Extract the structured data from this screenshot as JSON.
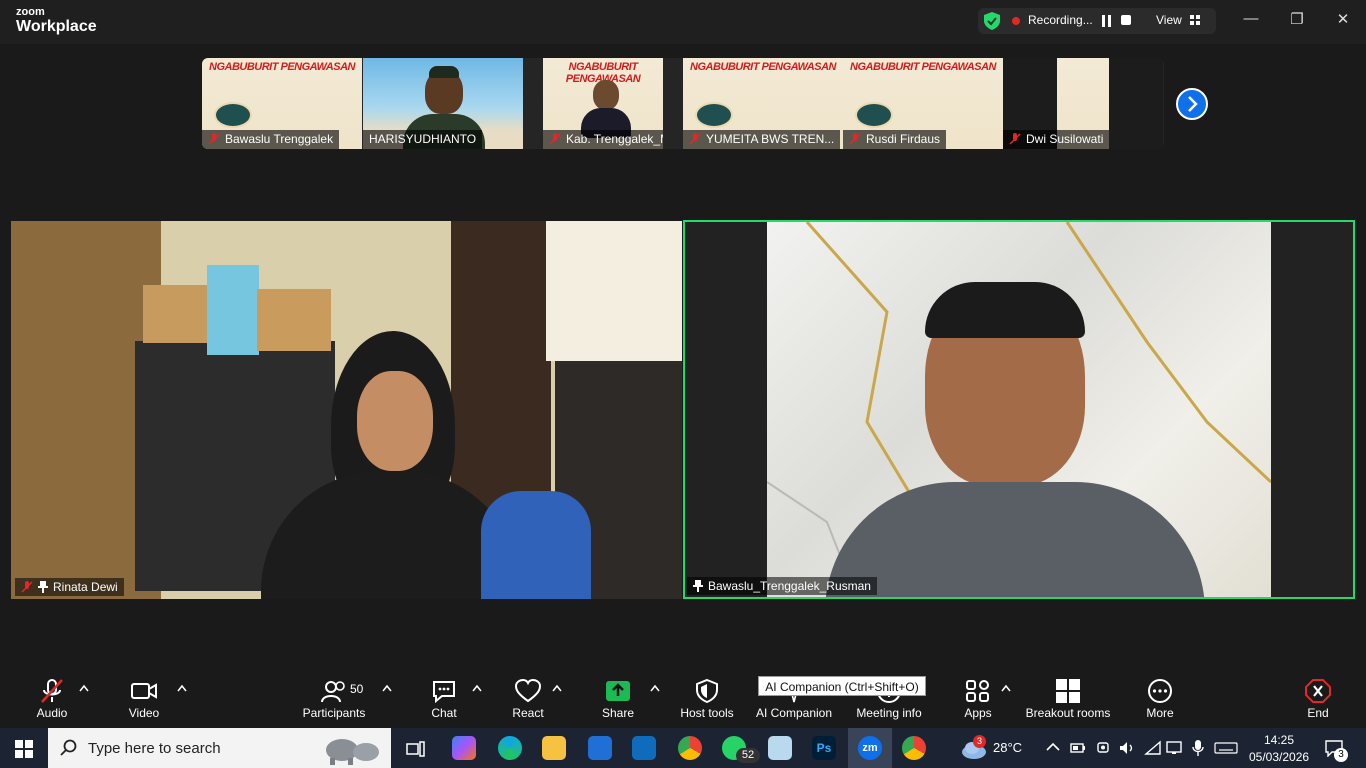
{
  "app": {
    "brand_small": "zoom",
    "brand_big": "Workplace"
  },
  "recording": {
    "status": "Recording...",
    "view_label": "View"
  },
  "thumbnails": [
    {
      "name": "Bawaslu Trenggalek",
      "muted": true
    },
    {
      "name": "HARISYUDHIANTO",
      "muted": false
    },
    {
      "name": "Kab. Trenggalek_Mas...",
      "muted": true
    },
    {
      "name": "YUMEITA BWS TREN...",
      "muted": true
    },
    {
      "name": "Rusdi Firdaus",
      "muted": true
    },
    {
      "name": "Dwi Susilowati",
      "muted": true
    }
  ],
  "poster_title": "NGABUBURIT PENGAWASAN",
  "videos": {
    "left": {
      "name": "Rinata Dewi"
    },
    "right": {
      "name": "Bawaslu_Trenggalek_Rusman"
    }
  },
  "toolbar": {
    "audio": "Audio",
    "video": "Video",
    "participants": "Participants",
    "participants_count": "50",
    "chat": "Chat",
    "react": "React",
    "share": "Share",
    "host_tools": "Host tools",
    "ai_companion": "AI Companion",
    "ai_tooltip": "AI Companion (Ctrl+Shift+O)",
    "meeting_info": "Meeting info",
    "apps": "Apps",
    "breakout": "Breakout rooms",
    "more": "More",
    "end": "End"
  },
  "taskbar": {
    "search_placeholder": "Type here to search",
    "whatsapp_badge": "52",
    "weather_badge": "3",
    "temperature": "28°C",
    "time": "14:25",
    "date": "05/03/2026",
    "notif_count": "3"
  },
  "colors": {
    "accent_green": "#23d96c",
    "zoom_blue": "#0e71eb",
    "end_red": "#e02828",
    "share_green": "#1db954"
  }
}
